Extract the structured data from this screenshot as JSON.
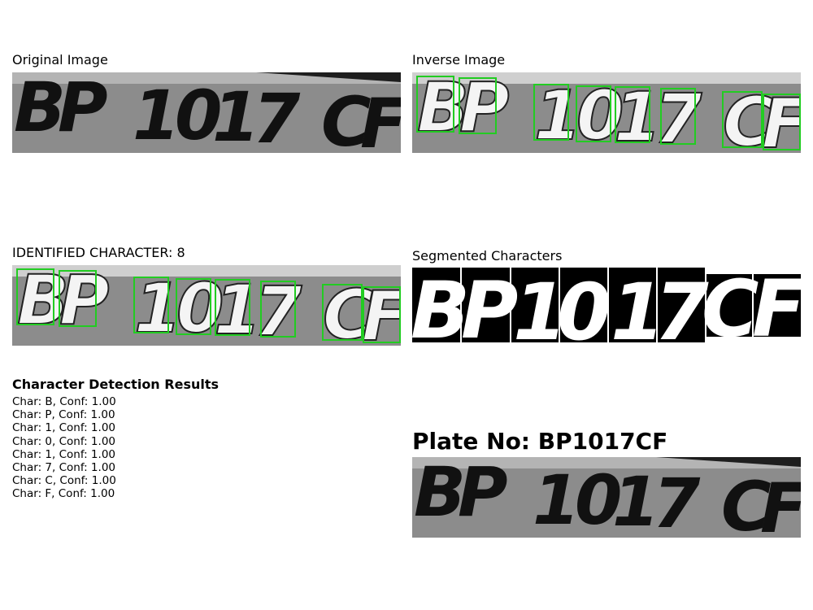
{
  "panels": {
    "original": {
      "title": "Original Image"
    },
    "inverse": {
      "title": "Inverse Image"
    },
    "identified": {
      "title": "IDENTIFIED CHARACTER: 8"
    },
    "segmented": {
      "title": "Segmented Characters"
    }
  },
  "plate_text": [
    "B",
    "P",
    "1",
    "0",
    "1",
    "7",
    "C",
    "F"
  ],
  "results": {
    "heading": "Character Detection Results",
    "items": [
      "Char: B, Conf: 1.00",
      "Char: P, Conf: 1.00",
      "Char: 1, Conf: 1.00",
      "Char: 0, Conf: 1.00",
      "Char: 1, Conf: 1.00",
      "Char: 7, Conf: 1.00",
      "Char: C, Conf: 1.00",
      "Char: F, Conf: 1.00"
    ]
  },
  "plate_number": "Plate No: BP1017CF",
  "colors": {
    "box": "#22cc22",
    "plate_bg": "#8f8f8f",
    "plate_top": "#2a2a2a",
    "seg_bg": "#000000",
    "seg_fg": "#ffffff"
  }
}
